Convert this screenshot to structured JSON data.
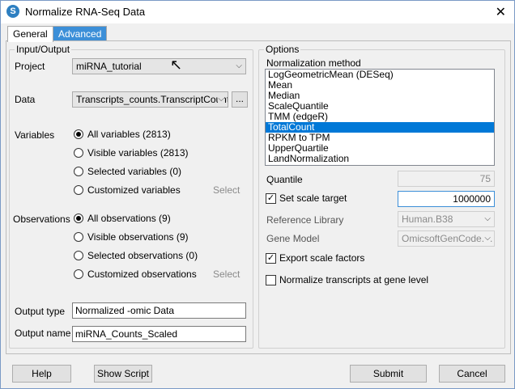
{
  "window": {
    "title": "Normalize RNA-Seq Data",
    "close": "✕"
  },
  "tabs": [
    {
      "label": "General"
    },
    {
      "label": "Advanced"
    }
  ],
  "io": {
    "legend": "Input/Output",
    "project_label": "Project",
    "project_value": "miRNA_tutorial",
    "data_label": "Data",
    "data_value": "Transcripts_counts.TranscriptCount",
    "data_browse": "...",
    "variables_label": "Variables",
    "variables": [
      "All variables (2813)",
      "Visible variables (2813)",
      "Selected variables (0)",
      "Customized variables"
    ],
    "variables_select": "Select",
    "observations_label": "Observations",
    "observations": [
      "All observations (9)",
      "Visible observations (9)",
      "Selected observations (0)",
      "Customized observations"
    ],
    "observations_select": "Select",
    "output_type_label": "Output type",
    "output_type_value": "Normalized -omic Data",
    "output_name_label": "Output name",
    "output_name_value": "miRNA_Counts_Scaled"
  },
  "options": {
    "legend": "Options",
    "method_label": "Normalization method",
    "methods": [
      "LogGeometricMean (DESeq)",
      "Mean",
      "Median",
      "ScaleQuantile",
      "TMM (edgeR)",
      "TotalCount",
      "RPKM to TPM",
      "UpperQuartile",
      "LandNormalization"
    ],
    "selected_method": "TotalCount",
    "quantile_label": "Quantile",
    "quantile_value": "75",
    "scale_target_label": "Set scale target",
    "scale_target_value": "1000000",
    "ref_library_label": "Reference Library",
    "ref_library_value": "Human.B38",
    "gene_model_label": "Gene Model",
    "gene_model_value": "OmicsoftGenCode.V.",
    "export_label": "Export scale factors",
    "normalize_transcripts_label": "Normalize transcripts at gene level"
  },
  "buttons": {
    "help": "Help",
    "show_script": "Show Script",
    "submit": "Submit",
    "cancel": "Cancel"
  }
}
